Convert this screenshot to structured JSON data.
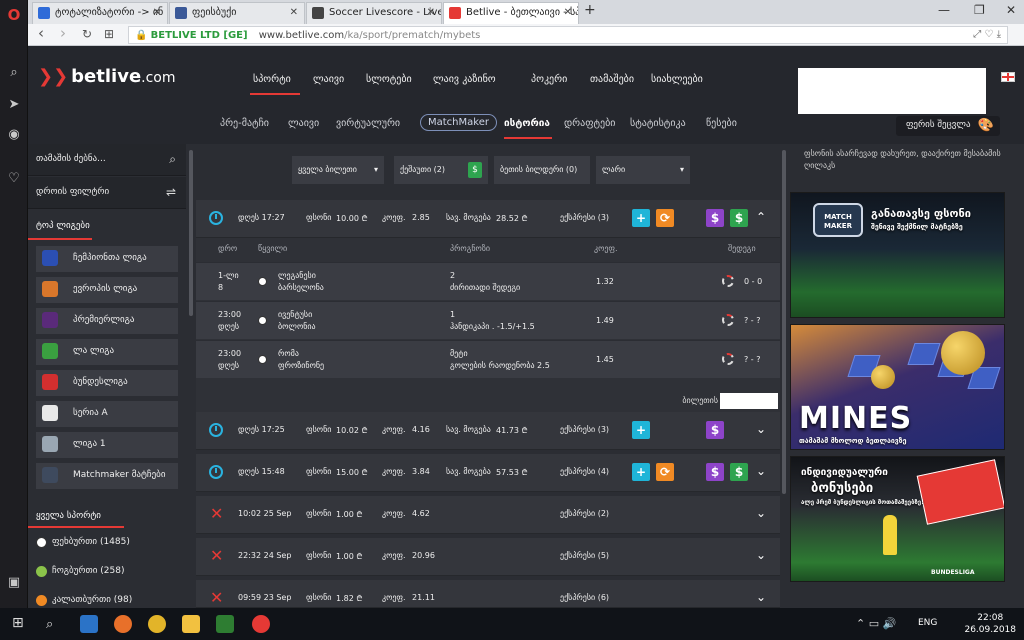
{
  "browser": {
    "tabs": [
      {
        "title": "ტოტალიზატორი -> ინ",
        "favicon_color": "#2f6bd8"
      },
      {
        "title": "ფეისბუქი",
        "favicon_color": "#3b5998"
      },
      {
        "title": "Soccer Livescore - Live Sc",
        "favicon_color": "#444444"
      },
      {
        "title": "Betlive - ბეთლაივი - სპ",
        "favicon_color": "#e53935"
      }
    ],
    "new_tab": "+",
    "win_min": "—",
    "win_max": "❐",
    "win_close": "✕",
    "tab_close": "✕",
    "back": "‹",
    "forward": "›",
    "reload": "↻",
    "grid": "⊞",
    "lock": "🔒",
    "corp_name": "BETLIVE LTD [GE]",
    "url_host": "www.betlive.com",
    "url_path": "/ka/sport/prematch/mybets",
    "url_right_icons": "⤢  ♡  ⤓"
  },
  "opera_sidebar": {
    "logo": "O",
    "search": "⌕",
    "send": "➤",
    "camera": "◉",
    "heart": "♡",
    "panel": "▣"
  },
  "site": {
    "logo_mark": "❯❯",
    "logo_text": "betlive",
    "logo_tld": ".com",
    "mainnav": [
      "სპორტი",
      "ლაივი",
      "სლოტები",
      "ლაივ კაზინო",
      "პოკერი",
      "თამაშები",
      "სიახლეები"
    ],
    "subnav": [
      "პრე-მატჩი",
      "ლაივი",
      "ვირტუალური",
      "MatchMaker",
      "ისტორია",
      "დრაფტები",
      "სტატისტიკა",
      "წესები"
    ],
    "color_button": "ფერის შეცვლა",
    "color_icon": "🎨"
  },
  "left_panel": {
    "search_label": "თამაშის ძებნა...",
    "search_icon": "⌕",
    "time_filter": "დროის ფილტრი",
    "filter_icon": "⇌",
    "top_leagues_title": "ტოპ ლიგები",
    "leagues": [
      {
        "name": "ჩემპიონთა ლიგა",
        "color": "#2b4fb3"
      },
      {
        "name": "ევროპის ლიგა",
        "color": "#d9772b"
      },
      {
        "name": "პრემიერლიგა",
        "color": "#5a2a7a"
      },
      {
        "name": "ლა ლიგა",
        "color": "#3aa040"
      },
      {
        "name": "ბუნდესლიგა",
        "color": "#d32f2f"
      },
      {
        "name": "სერია A",
        "color": "#e8e8e8"
      },
      {
        "name": "ლიგა 1",
        "color": "#9aa7b3"
      },
      {
        "name": "Matchmaker მატჩები",
        "color": "#3e4a5e"
      }
    ],
    "all_sports_title": "ყველა სპორტი",
    "sports": [
      {
        "name": "ფეხბურთი (1485)",
        "color": "#ffffff"
      },
      {
        "name": "ჩოგბურთი (258)",
        "color": "#8bc34a"
      },
      {
        "name": "კალათბურთი (98)",
        "color": "#f08a24"
      }
    ]
  },
  "filters": {
    "all_bets": "ყველა ბილეთი",
    "caret": "▾",
    "cashout": "ქეშაუთი (2)",
    "dollar": "$",
    "bet_builder": "ბეთის ბილდერი (0)",
    "currency": "ლარი"
  },
  "bets": [
    {
      "status": "pending",
      "date": "დღეს 17:27",
      "stake_label": "ფსონი",
      "stake": "10.00 ₾",
      "coef_label": "კოეფ.",
      "coef": "2.85",
      "win_label": "სავ. მოგება",
      "win": "28.52 ₾",
      "events": "ექსპრესი (3)",
      "expanded": true,
      "icons": [
        "plus",
        "refresh",
        "s-purple",
        "dollar"
      ]
    },
    {
      "status": "pending",
      "date": "დღეს 17:25",
      "stake_label": "ფსონი",
      "stake": "10.02 ₾",
      "coef_label": "კოეფ.",
      "coef": "4.16",
      "win_label": "სავ. მოგება",
      "win": "41.73 ₾",
      "events": "ექსპრესი (3)",
      "expanded": false,
      "icons": [
        "plus",
        "s-purple"
      ]
    },
    {
      "status": "pending",
      "date": "დღეს 15:48",
      "stake_label": "ფსონი",
      "stake": "15.00 ₾",
      "coef_label": "კოეფ.",
      "coef": "3.84",
      "win_label": "სავ. მოგება",
      "win": "57.53 ₾",
      "events": "ექსპრესი (4)",
      "expanded": false,
      "icons": [
        "plus",
        "refresh",
        "s-purple",
        "dollar"
      ]
    },
    {
      "status": "lost",
      "date": "10:02 25 Sep",
      "stake_label": "ფსონი",
      "stake": "1.00 ₾",
      "coef_label": "კოეფ.",
      "coef": "4.62",
      "win_label": "",
      "win": "",
      "events": "ექსპრესი (2)",
      "expanded": false,
      "icons": []
    },
    {
      "status": "lost",
      "date": "22:32 24 Sep",
      "stake_label": "ფსონი",
      "stake": "1.00 ₾",
      "coef_label": "კოეფ.",
      "coef": "20.96",
      "win_label": "",
      "win": "",
      "events": "ექსპრესი (5)",
      "expanded": false,
      "icons": []
    },
    {
      "status": "lost",
      "date": "09:59 23 Sep",
      "stake_label": "ფსონი",
      "stake": "1.82 ₾",
      "coef_label": "კოეფ.",
      "coef": "21.11",
      "win_label": "",
      "win": "",
      "events": "ექსპრესი (6)",
      "expanded": false,
      "icons": []
    }
  ],
  "bet_icons": {
    "plus": "+",
    "refresh": "⟳",
    "s": "$",
    "dollar": "$",
    "chevron_up": "⌃",
    "chevron_down": "⌄",
    "x": "✕"
  },
  "detail": {
    "headers": [
      "დრო",
      "წყვილი",
      "პროგნოზი",
      "კოეფ.",
      "შედეგი"
    ],
    "rows": [
      {
        "time": "1-ლი",
        "time2": "8",
        "team1": "ლეგანესი",
        "team2": "ბარსელონა",
        "pick1": "2",
        "pick2": "ძირითადი შედეგი",
        "coef": "1.32",
        "result": "0 - 0"
      },
      {
        "time": "23:00",
        "time2": "დღეს",
        "team1": "ივენტუსი",
        "team2": "ბოლონია",
        "pick1": "1",
        "pick2": "ჰანდიკაპი . -1.5/+1.5",
        "coef": "1.49",
        "result": "? - ?"
      },
      {
        "time": "23:00",
        "time2": "დღეს",
        "team1": "რომა",
        "team2": "ფროზინონე",
        "pick1": "მეტი",
        "pick2": "გოლების რაოდენობა 2.5",
        "coef": "1.45",
        "result": "? - ?"
      }
    ],
    "bid_label": "ბილეთის"
  },
  "right_panel": {
    "text": "ფსონის ასარჩევად დახურეთ, დააქირეთ მესაბამის ღილაკს",
    "banner1_title": "განათავსე ფსონი",
    "banner1_sub": "შენივე შექმნილ მატჩებზე",
    "banner1_logo": "MATCH MAKER",
    "banner2_title": "MINES",
    "banner2_sub": "თამაშამ მხოლოდ ბეთლაივზე",
    "banner3_title1": "ინდივიდუალური",
    "banner3_title2": "ბონუსები",
    "banner3_sub": "ალე პრემ ბუნდესლიგის მოთამაშეებზე!",
    "banner3_brand": "BUNDESLIGA"
  },
  "taskbar": {
    "start": "⊞",
    "search": "⌕",
    "lang": "ENG",
    "time": "22:08",
    "date": "26.09.2018",
    "tray": "⌃  ▭  🔊"
  },
  "colors": {
    "accent": "#e53935",
    "clock": "#2ab3e0",
    "plus": "#1fb5d8",
    "refresh": "#f08a24",
    "purple": "#8e44c9",
    "green": "#2ea44f"
  }
}
